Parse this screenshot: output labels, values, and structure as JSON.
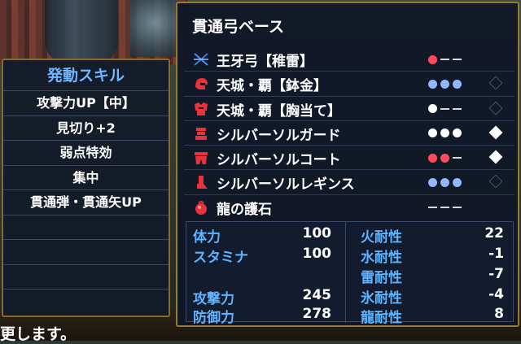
{
  "skill_panel": {
    "title": "発動スキル",
    "skills": [
      "攻撃力UP【中】",
      "見切り+2",
      "弱点特効",
      "集中",
      "貫通弾・貫通矢UP"
    ]
  },
  "equipment_panel": {
    "title": "貫通弓ベース",
    "items": [
      {
        "icon": "bow-icon",
        "name": "王牙弓【稚雷】",
        "slots": [
          "red",
          "dash",
          "dash"
        ],
        "decoration": "none"
      },
      {
        "icon": "helmet-icon",
        "name": "天城・覇【鉢金】",
        "slots": [
          "blue",
          "blue",
          "blue"
        ],
        "decoration": "off"
      },
      {
        "icon": "chest-armor-icon",
        "name": "天城・覇【胸当て】",
        "slots": [
          "white",
          "dash",
          "dash"
        ],
        "decoration": "off"
      },
      {
        "icon": "arm-armor-icon",
        "name": "シルバーソルガード",
        "slots": [
          "white",
          "white",
          "white"
        ],
        "decoration": "on"
      },
      {
        "icon": "waist-armor-icon",
        "name": "シルバーソルコート",
        "slots": [
          "red",
          "red",
          "dash"
        ],
        "decoration": "on"
      },
      {
        "icon": "leg-armor-icon",
        "name": "シルバーソルレギンス",
        "slots": [
          "blue",
          "blue",
          "blue"
        ],
        "decoration": "off"
      },
      {
        "icon": "talisman-icon",
        "name": "龍の護石",
        "slots": [
          "dash",
          "dash",
          "dash"
        ],
        "decoration": "none"
      }
    ]
  },
  "stats": {
    "health_label": "体力",
    "health_value": "100",
    "stamina_label": "スタミナ",
    "stamina_value": "100",
    "attack_label": "攻撃力",
    "attack_value": "245",
    "defense_label": "防御力",
    "defense_value": "278",
    "fire_res_label": "火耐性",
    "fire_res_value": "22",
    "water_res_label": "水耐性",
    "water_res_value": "-1",
    "thunder_res_label": "雷耐性",
    "thunder_res_value": "-7",
    "ice_res_label": "氷耐性",
    "ice_res_value": "-4",
    "dragon_res_label": "龍耐性",
    "dragon_res_value": "8"
  },
  "bottom_text": "更します。",
  "colors": {
    "skill_title": "#6fb6ff",
    "stat_label": "#5fb4ff",
    "panel_border": "#9a7a2e",
    "slot_red": "#ff4a5e",
    "slot_blue": "#8fb8ff",
    "icon_red": "#e8323c",
    "icon_blue": "#4a8cff"
  }
}
